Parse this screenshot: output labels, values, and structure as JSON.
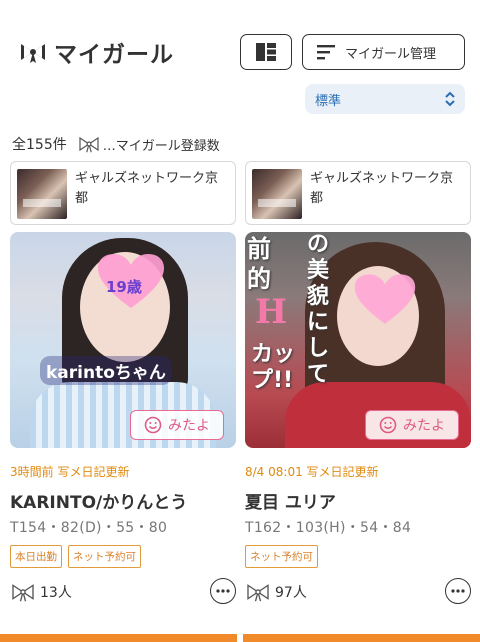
{
  "header": {
    "title": "マイガール",
    "manage_label": "マイガール管理"
  },
  "sort": {
    "selected": "標準"
  },
  "summary": {
    "total": "全155件",
    "legend": "…マイガール登録数"
  },
  "cards": [
    {
      "shop": "ギャルズネットワーク京都",
      "photo_text": "karintoちゃん",
      "photo_age": "19歳",
      "mita_label": "みたよ",
      "update": "3時間前 写メ日記更新",
      "name": "KARINTO/かりんとう",
      "spec": "T154・82(D)・55・80",
      "badges": [
        "本日出勤",
        "ネット予約可"
      ],
      "fav_count": "13人"
    },
    {
      "shop": "ギャルズネットワーク京都",
      "photo_text": "の美貌にして",
      "photo_text2": "前的",
      "photo_hcup": "H",
      "photo_cup": "カップ!!",
      "mita_label": "みたよ",
      "update": "8/4 08:01 写メ日記更新",
      "name": "夏目 ユリア",
      "spec": "T162・103(H)・54・84",
      "badges": [
        "ネット予約可"
      ],
      "fav_count": "97人"
    }
  ],
  "colors": {
    "accent_orange": "#e08a10",
    "pink": "#e05a86",
    "link_blue": "#2a6fb5"
  },
  "icons": [
    "ribbon-icon",
    "grid-layout-icon",
    "list-lines-icon",
    "chevron-updown-icon",
    "smile-icon",
    "more-icon"
  ]
}
